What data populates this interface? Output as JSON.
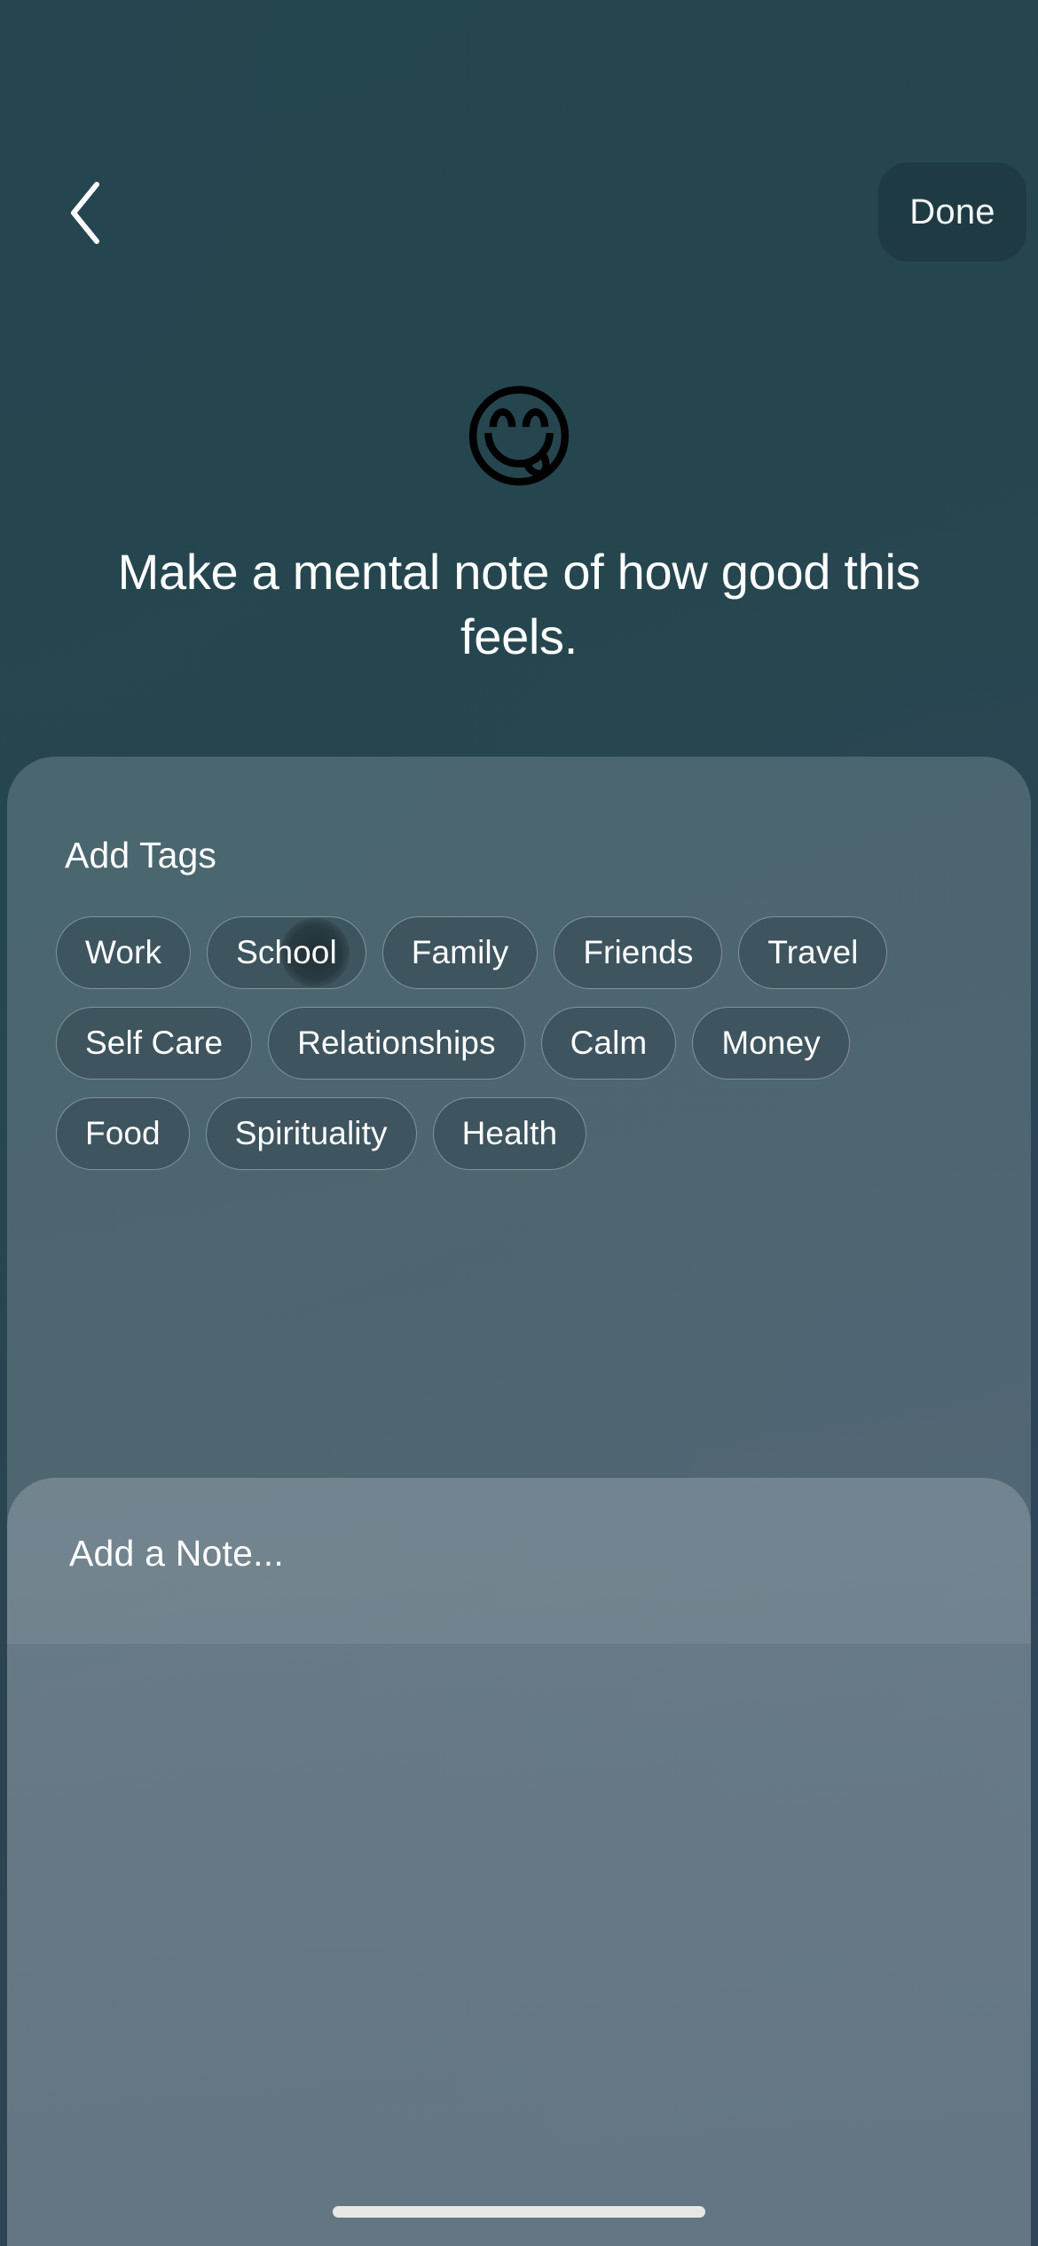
{
  "header": {
    "back_icon": "chevron-left-icon",
    "done_label": "Done"
  },
  "hero": {
    "emoji": "😋",
    "emoji_name": "face-savoring-food-emoji",
    "headline": "Make a mental note of how good this feels."
  },
  "tags_section": {
    "title": "Add Tags",
    "chips": [
      {
        "label": "Work",
        "pressed": false
      },
      {
        "label": "School",
        "pressed": true
      },
      {
        "label": "Family",
        "pressed": false
      },
      {
        "label": "Friends",
        "pressed": false
      },
      {
        "label": "Travel",
        "pressed": false
      },
      {
        "label": "Self Care",
        "pressed": false
      },
      {
        "label": "Relationships",
        "pressed": false
      },
      {
        "label": "Calm",
        "pressed": false
      },
      {
        "label": "Money",
        "pressed": false
      },
      {
        "label": "Food",
        "pressed": false
      },
      {
        "label": "Spirituality",
        "pressed": false
      },
      {
        "label": "Health",
        "pressed": false
      }
    ]
  },
  "note_section": {
    "placeholder": "Add a Note...",
    "value": ""
  },
  "system": {
    "home_indicator": "home-indicator"
  },
  "colors": {
    "background_top": "#24454d",
    "background_bottom_right": "#304457",
    "tags_card": "#62777f",
    "note_card": "#7a8b96",
    "text_primary": "#ffffff",
    "chip_fill": "#2f444e",
    "chip_border": "#e2ecf0",
    "home_indicator": "#e7e7e6"
  }
}
